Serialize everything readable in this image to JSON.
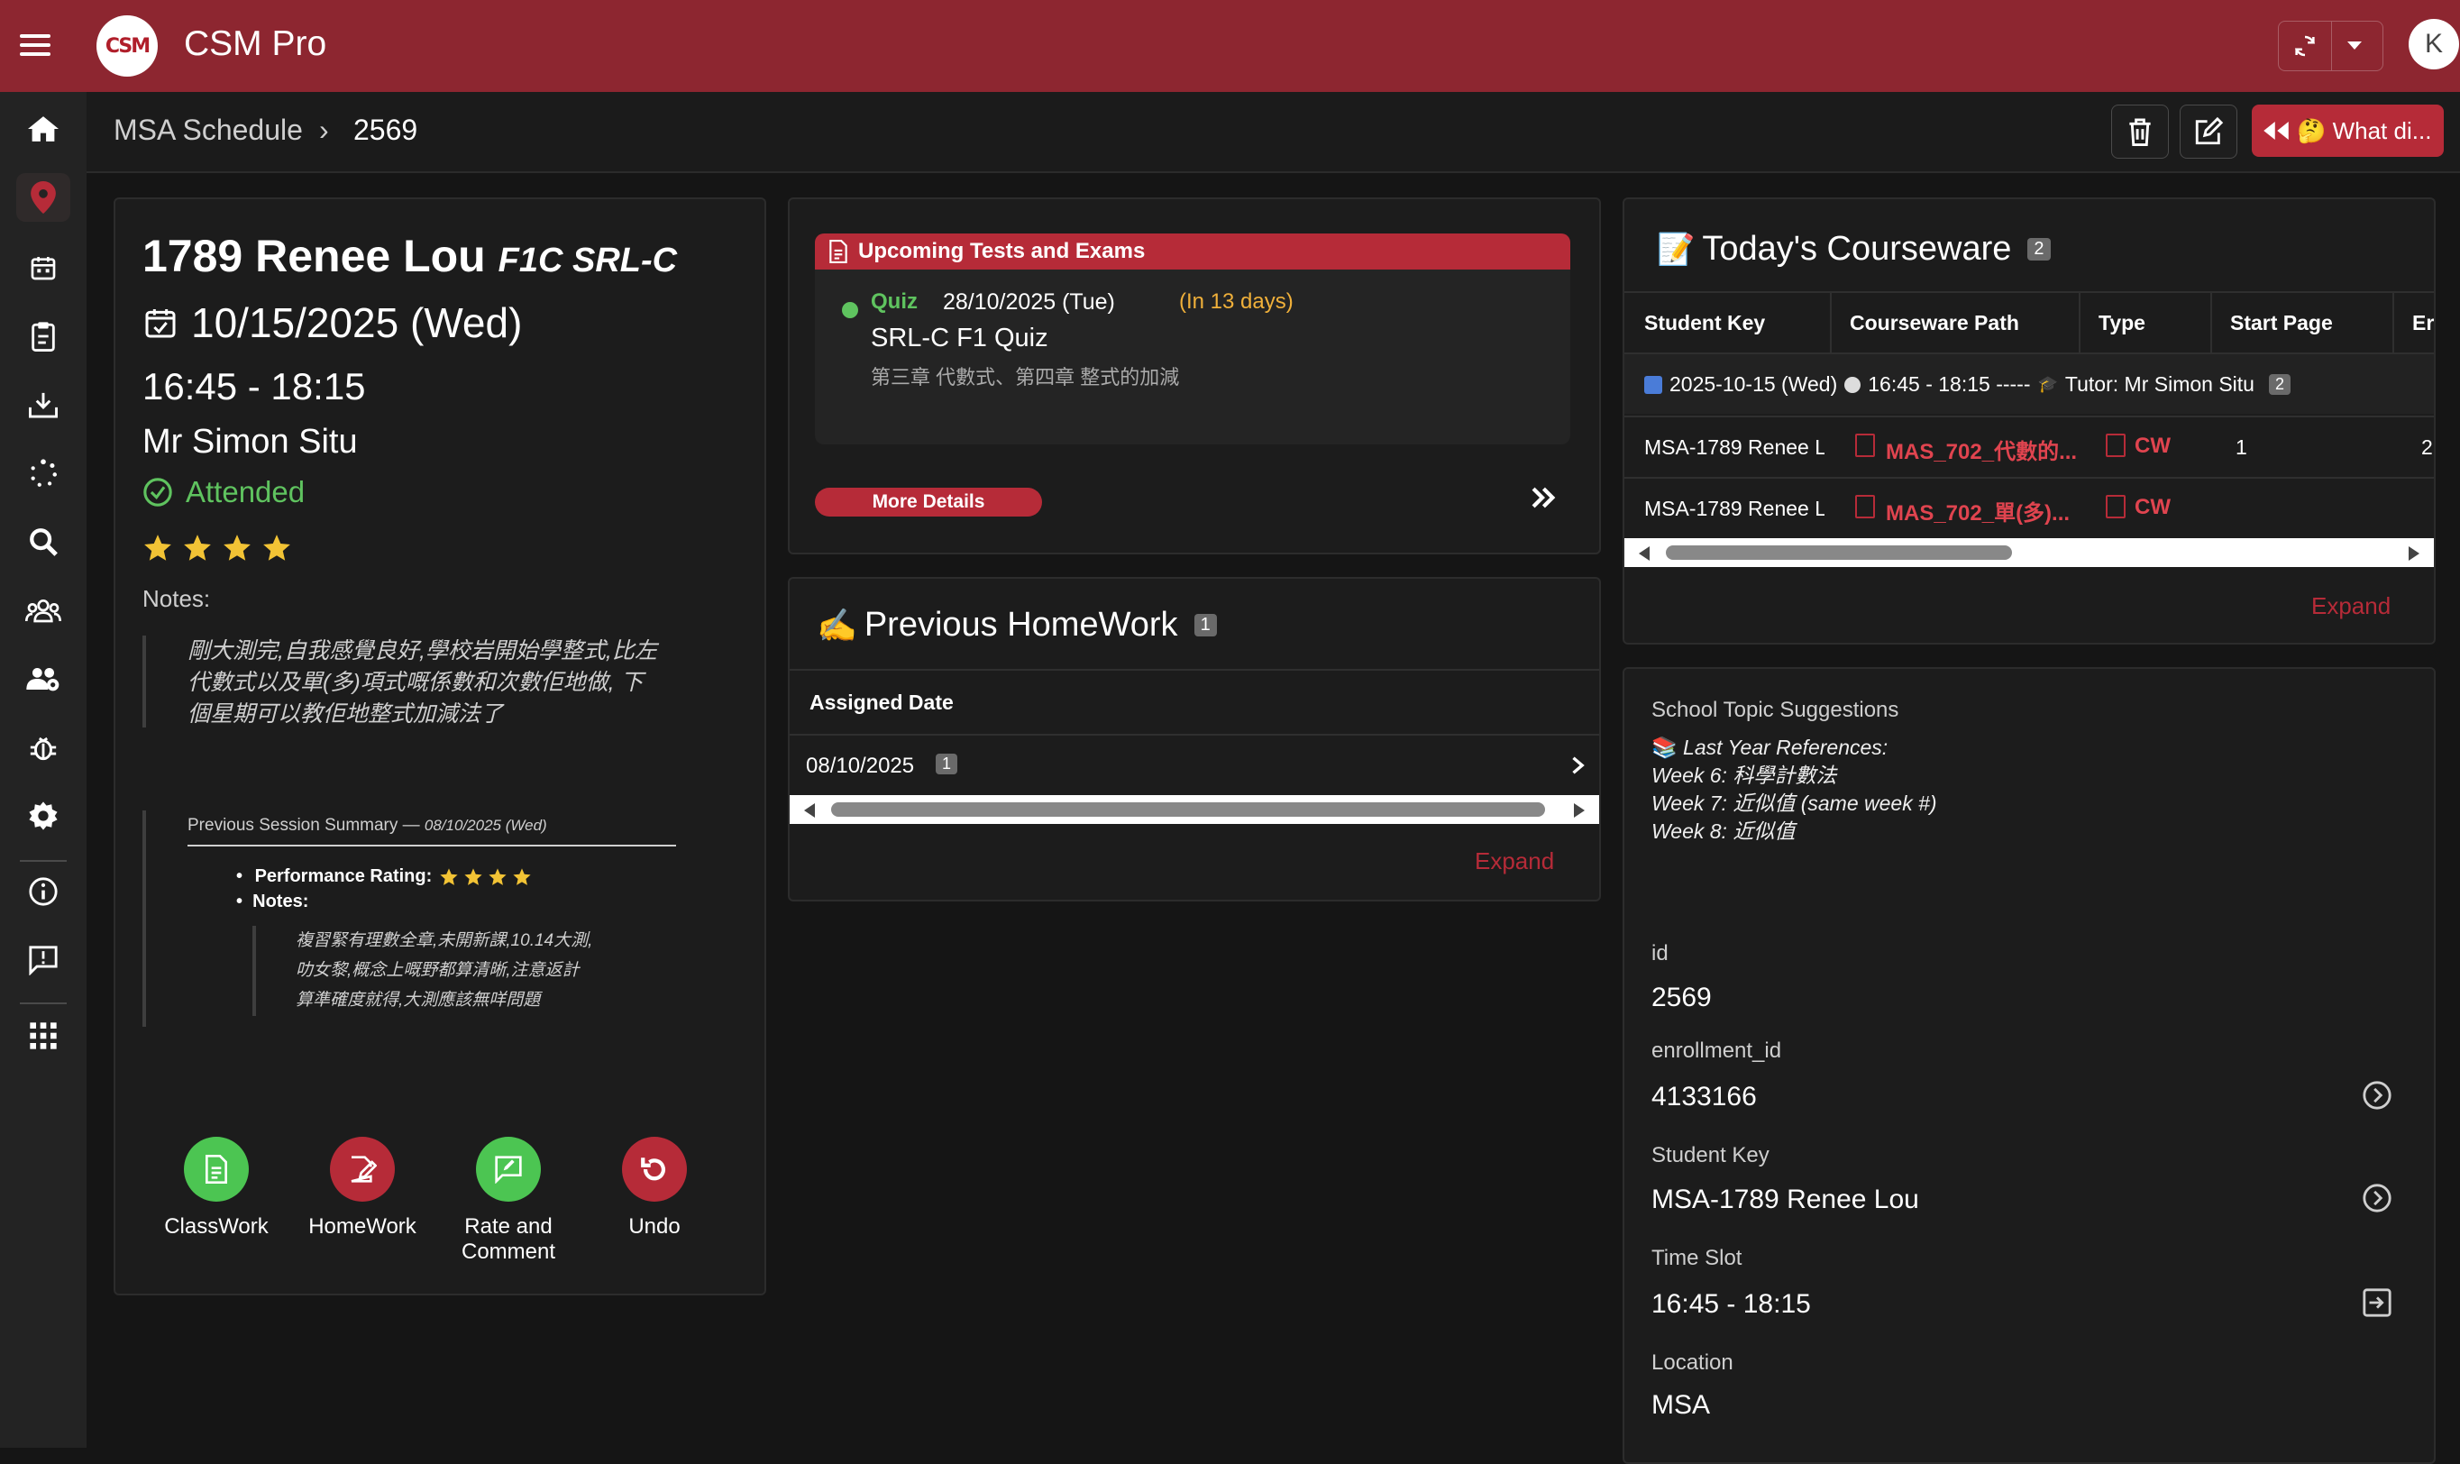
{
  "app": {
    "title": "CSM Pro",
    "logo_text": "CSM",
    "user_initial": "K"
  },
  "breadcrumb": {
    "parent": "MSA Schedule",
    "current": "2569"
  },
  "header_actions": {
    "what_label": "🤔 What di..."
  },
  "session": {
    "student_name": "1789 Renee Lou",
    "class_code": "F1C SRL-C",
    "date": "10/15/2025 (Wed)",
    "time": "16:45 - 18:15",
    "tutor": "Mr Simon Situ",
    "status": "Attended",
    "rating": 4,
    "notes_label": "Notes:",
    "notes": [
      "剛大測完,自我感覺良好,學校岩開始學整式,比左",
      "代數式以及單(多)項式嘅係數和次數佢地做, 下",
      "個星期可以教佢地整式加減法了"
    ],
    "previous": {
      "title": "Previous Session Summary — ",
      "date": "08/10/2025 (Wed)",
      "rating_label": "Performance Rating:",
      "rating": 4,
      "notes_label": "Notes:",
      "notes": [
        "複習緊有理數全章,未開新課,10.14大測,",
        "叻女黎,概念上嘅野都算清晰,注意返計",
        "算準確度就得,大測應該無咩問題"
      ]
    },
    "actions": [
      {
        "label": "ClassWork",
        "color": "#4cc552"
      },
      {
        "label": "HomeWork",
        "color": "#b62b38"
      },
      {
        "label": "Rate and",
        "label2": "Comment",
        "color": "#4cc552"
      },
      {
        "label": "Undo",
        "color": "#b62b38"
      }
    ]
  },
  "upcoming": {
    "title": "Upcoming Tests and Exams",
    "type": "Quiz",
    "date": "28/10/2025 (Tue)",
    "countdown": "(In 13 days)",
    "name": "SRL-C F1 Quiz",
    "topics": "第三章 代數式、第四章 整式的加減",
    "more_label": "More Details"
  },
  "homework": {
    "title": "Previous HomeWork",
    "count": "1",
    "column": "Assigned Date",
    "rows": [
      {
        "date": "08/10/2025",
        "count": "1"
      }
    ],
    "expand_label": "Expand"
  },
  "courseware": {
    "title": "Today's Courseware",
    "count": "2",
    "columns": [
      "Student Key",
      "Courseware Path",
      "Type",
      "Start Page",
      "Er"
    ],
    "group": {
      "date": "2025-10-15 (Wed)",
      "time": "16:45 - 18:15 -----",
      "tutor": "Tutor: Mr Simon Situ",
      "count": "2"
    },
    "rows": [
      {
        "student": "MSA-1789 Renee Lc",
        "path": "MAS_702_代數的...",
        "type": "CW",
        "start": "1",
        "end": "2"
      },
      {
        "student": "MSA-1789 Renee Lc",
        "path": "MAS_702_單(多)...",
        "type": "CW",
        "start": "",
        "end": ""
      }
    ],
    "expand_label": "Expand"
  },
  "details": {
    "suggestions_label": "School Topic Suggestions",
    "suggestions": [
      "Last Year References:",
      "Week 6: 科學計數法",
      "Week 7: 近似值 (same week #)",
      "Week 8: 近似值"
    ],
    "fields": [
      {
        "label": "id",
        "value": "2569"
      },
      {
        "label": "enrollment_id",
        "value": "4133166"
      },
      {
        "label": "Student Key",
        "value": "MSA-1789 Renee Lou"
      },
      {
        "label": "Time Slot",
        "value": "16:45 - 18:15"
      },
      {
        "label": "Location",
        "value": "MSA"
      }
    ]
  },
  "colors": {
    "brand": "#8d2630",
    "accent": "#b62b38",
    "success": "#5fc35f",
    "star": "#f2c335",
    "warning": "#f0b03a"
  }
}
